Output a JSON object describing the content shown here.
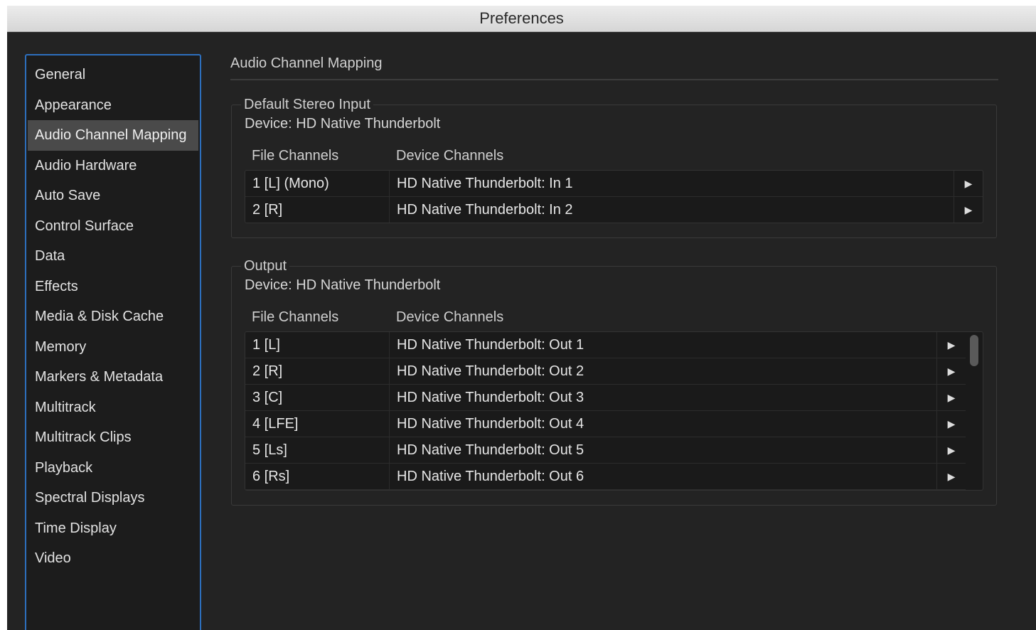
{
  "window": {
    "title": "Preferences"
  },
  "sidebar": {
    "items": [
      {
        "label": "General",
        "selected": false
      },
      {
        "label": "Appearance",
        "selected": false
      },
      {
        "label": "Audio Channel Mapping",
        "selected": true
      },
      {
        "label": "Audio Hardware",
        "selected": false
      },
      {
        "label": "Auto Save",
        "selected": false
      },
      {
        "label": "Control Surface",
        "selected": false
      },
      {
        "label": "Data",
        "selected": false
      },
      {
        "label": "Effects",
        "selected": false
      },
      {
        "label": "Media & Disk Cache",
        "selected": false
      },
      {
        "label": "Memory",
        "selected": false
      },
      {
        "label": "Markers & Metadata",
        "selected": false
      },
      {
        "label": "Multitrack",
        "selected": false
      },
      {
        "label": "Multitrack Clips",
        "selected": false
      },
      {
        "label": "Playback",
        "selected": false
      },
      {
        "label": "Spectral Displays",
        "selected": false
      },
      {
        "label": "Time Display",
        "selected": false
      },
      {
        "label": "Video",
        "selected": false
      }
    ]
  },
  "main": {
    "title": "Audio Channel Mapping",
    "stereo_input": {
      "legend": "Default Stereo Input",
      "device": "Device: HD Native Thunderbolt",
      "col_file": "File Channels",
      "col_device": "Device Channels",
      "rows": [
        {
          "file": "1 [L] (Mono)",
          "device": "HD Native Thunderbolt: In 1"
        },
        {
          "file": "2 [R]",
          "device": "HD Native Thunderbolt: In 2"
        }
      ]
    },
    "output": {
      "legend": "Output",
      "device": "Device: HD Native Thunderbolt",
      "col_file": "File Channels",
      "col_device": "Device Channels",
      "rows": [
        {
          "file": "1 [L]",
          "device": "HD Native Thunderbolt: Out 1"
        },
        {
          "file": "2 [R]",
          "device": "HD Native Thunderbolt: Out 2"
        },
        {
          "file": "3 [C]",
          "device": "HD Native Thunderbolt: Out 3"
        },
        {
          "file": "4 [LFE]",
          "device": "HD Native Thunderbolt: Out 4"
        },
        {
          "file": "5 [Ls]",
          "device": "HD Native Thunderbolt: Out 5"
        },
        {
          "file": "6 [Rs]",
          "device": "HD Native Thunderbolt: Out 6"
        }
      ]
    }
  },
  "icons": {
    "row_menu": "triangle-right-icon"
  },
  "colors": {
    "accent": "#2d6fbd",
    "background": "#232323",
    "selection": "#4a4a4a"
  }
}
